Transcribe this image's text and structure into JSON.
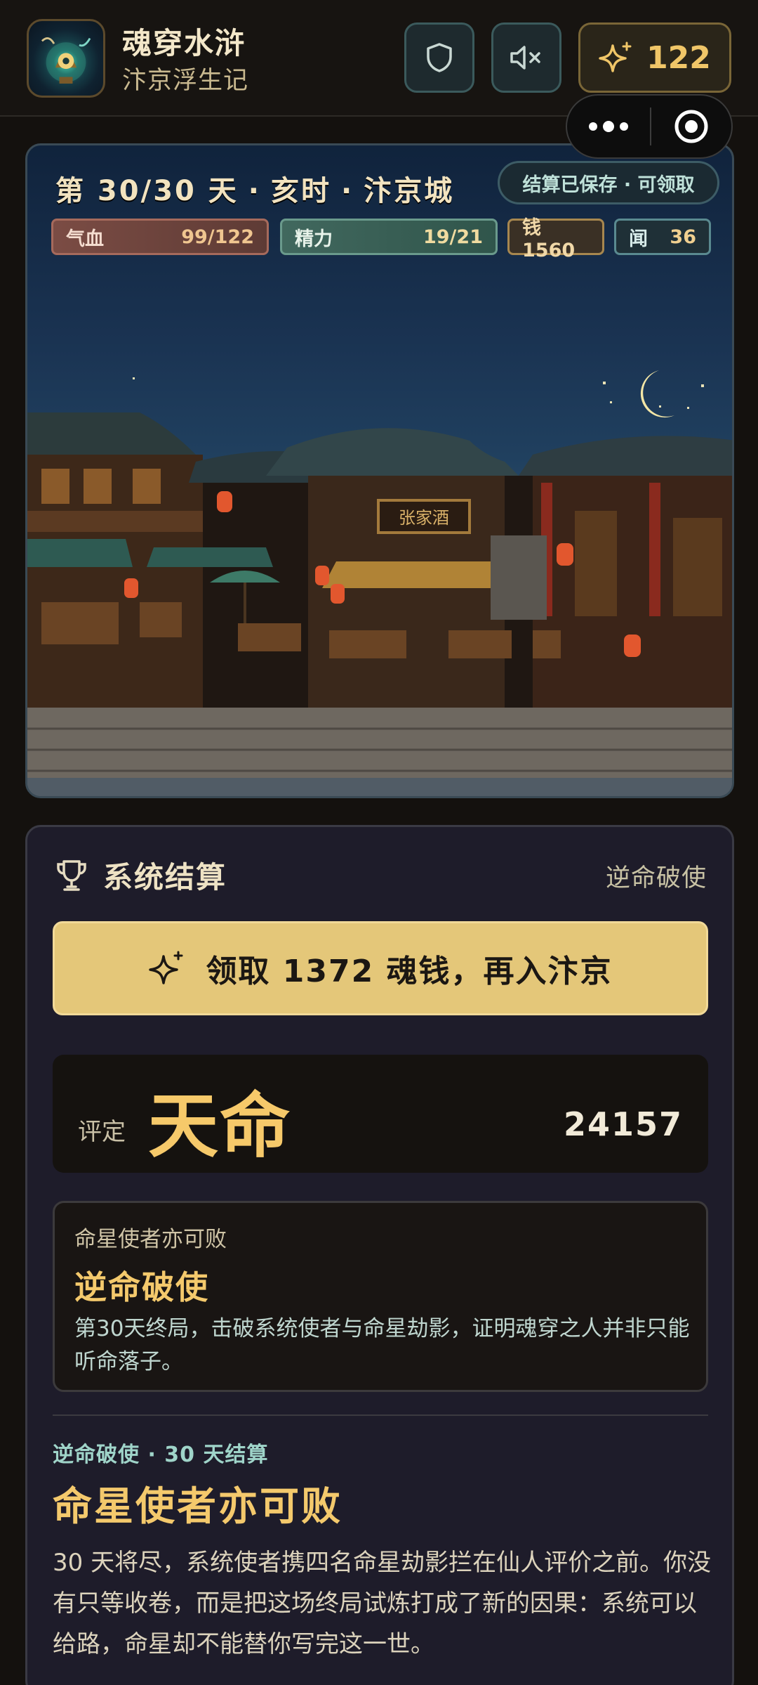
{
  "header": {
    "app_title": "魂穿水浒",
    "app_subtitle": "汴京浮生记",
    "points": "122",
    "icons": {
      "shield": "shield-icon",
      "mute": "speaker-mute-icon",
      "points": "sparkle-icon"
    }
  },
  "capsule": {
    "more": "more-dots-icon",
    "close": "target-close-icon"
  },
  "scene": {
    "day": "第 30/30 天",
    "time": "亥时",
    "place": "汴京城",
    "separator": "·",
    "saved_badge": "结算已保存 · 可领取",
    "stats": {
      "hp_label": "气血",
      "hp_value": "99/122",
      "hp_fraction": 0.81,
      "energy_label": "精力",
      "energy_value": "19/21",
      "energy_fraction": 0.9,
      "money_label": "钱1560",
      "reputation_label": "闻",
      "reputation_value": "36"
    },
    "shop_sign": "张家酒"
  },
  "settlement": {
    "title": "系统结算",
    "tag": "逆命破使",
    "claim_button": "领取 1372 魂钱，再入汴京",
    "rating_label": "评定",
    "rating_value": "天命",
    "score": "24157",
    "achievement": {
      "subtitle": "命星使者亦可败",
      "title": "逆命破使",
      "description": "第30天终局，击破系统使者与命星劫影，证明魂穿之人并非只能听命落子。"
    },
    "story": {
      "kicker": "逆命破使 · 30 天结算",
      "title": "命星使者亦可败",
      "body": "30 天将尽，系统使者携四名命星劫影拦在仙人评价之前。你没有只等收卷，而是把这场终局试炼打成了新的因果：系统可以给路，命星却不能替你写完这一世。"
    }
  },
  "colors": {
    "accent_gold": "#e4c779",
    "rating_gold": "#f6c96a",
    "teal": "#9fd4c9",
    "card_bg": "#1e1c2a"
  }
}
